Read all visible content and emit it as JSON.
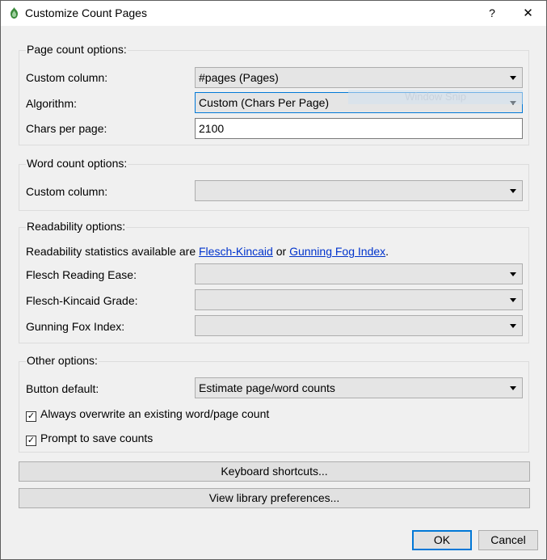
{
  "window": {
    "title": "Customize Count Pages",
    "help_label": "?",
    "close_label": "✕"
  },
  "page_count": {
    "group_title": "Page count options:",
    "custom_column_label": "Custom column:",
    "custom_column_value": "#pages (Pages)",
    "algorithm_label": "Algorithm:",
    "algorithm_value": "Custom (Chars Per Page)",
    "chars_label": "Chars per page:",
    "chars_value": "2100",
    "overlay_text": "Window Snip"
  },
  "word_count": {
    "group_title": "Word count options:",
    "custom_column_label": "Custom column:",
    "custom_column_value": ""
  },
  "readability": {
    "group_title": "Readability options:",
    "info_prefix": "Readability statistics available are ",
    "link1": "Flesch-Kincaid",
    "info_mid": " or ",
    "link2": "Gunning Fog Index",
    "info_suffix": ".",
    "flesch_ease_label": "Flesch Reading Ease:",
    "flesch_ease_value": "",
    "flesch_grade_label": "Flesch-Kincaid Grade:",
    "flesch_grade_value": "",
    "gunning_label": "Gunning Fox Index:",
    "gunning_value": ""
  },
  "other": {
    "group_title": "Other options:",
    "button_default_label": "Button default:",
    "button_default_value": "Estimate page/word counts",
    "overwrite_label": "Always overwrite an existing word/page count",
    "overwrite_checked": true,
    "prompt_label": "Prompt to save counts",
    "prompt_checked": true
  },
  "buttons": {
    "keyboard_shortcuts": "Keyboard shortcuts...",
    "view_library_prefs": "View library preferences...",
    "ok": "OK",
    "cancel": "Cancel"
  },
  "colors": {
    "accent": "#0078d7",
    "link": "#0033cc",
    "background": "#f0f0f0"
  }
}
